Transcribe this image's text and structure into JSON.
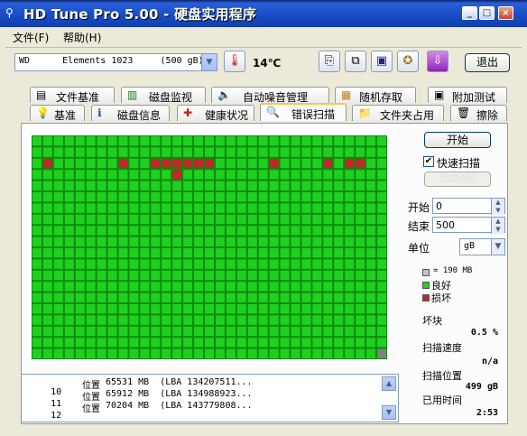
{
  "window": {
    "title": "HD Tune Pro 5.00 - 硬盘实用程序",
    "minimize": "_",
    "maximize": "□",
    "close": "×"
  },
  "menu": {
    "file": "文件(F)",
    "help": "帮助(H)"
  },
  "toolbar": {
    "drive_text": "WD      Elements 1023     (500 gB)",
    "temperature": "14℃",
    "exit_label": "退出"
  },
  "tabs_row1": [
    {
      "label": "文件基准",
      "icon": "file-benchmark-icon"
    },
    {
      "label": "磁盘监视",
      "icon": "disk-monitor-icon"
    },
    {
      "label": "自动噪音管理",
      "icon": "speaker-icon"
    },
    {
      "label": "随机存取",
      "icon": "random-access-icon"
    },
    {
      "label": "附加测试",
      "icon": "extra-tests-icon"
    }
  ],
  "tabs_row2": [
    {
      "label": "基准",
      "icon": "bulb-icon"
    },
    {
      "label": "磁盘信息",
      "icon": "info-icon"
    },
    {
      "label": "健康状况",
      "icon": "health-cross-icon"
    },
    {
      "label": "错误扫描",
      "icon": "magnifier-icon"
    },
    {
      "label": "文件夹占用",
      "icon": "folder-icon"
    },
    {
      "label": "擦除",
      "icon": "trash-icon"
    }
  ],
  "active_tab": "错误扫描",
  "scan": {
    "grid_cols": 33,
    "grid_rows": 20,
    "damaged_blocks": [
      [
        2,
        1
      ],
      [
        2,
        8
      ],
      [
        2,
        11
      ],
      [
        2,
        12
      ],
      [
        2,
        13
      ],
      [
        2,
        14
      ],
      [
        3,
        13
      ],
      [
        2,
        15
      ],
      [
        2,
        16
      ],
      [
        2,
        22
      ],
      [
        2,
        27
      ],
      [
        2,
        29
      ],
      [
        2,
        30
      ]
    ],
    "colors": {
      "good": "#1fd11f",
      "damaged": "#c0282a",
      "grid_line": "#0f8a0f",
      "unscanned": "#808080"
    }
  },
  "log_rows": [
    {
      "index": "10",
      "label": "位置",
      "text": "65531 MB  (LBA 134207511..."
    },
    {
      "index": "11",
      "label": "位置",
      "text": "65912 MB  (LBA 134988923..."
    },
    {
      "index": "12",
      "label": "位置",
      "text": "70204 MB  (LBA 143779808..."
    }
  ],
  "controls": {
    "start_button": "开始",
    "quick_scan_label": "快速扫描",
    "quick_scan_checked": true,
    "disabled_button": "快速扫描",
    "start_label": "开始",
    "start_value": "0",
    "end_label": "结束",
    "end_value": "500",
    "unit_label": "单位",
    "unit_value": "gB"
  },
  "legend": {
    "block_size": "= 190 MB",
    "good": "良好",
    "bad": "损坏"
  },
  "stats": {
    "bad_blocks_label": "坏块",
    "bad_blocks_value": "0.5 %",
    "scan_speed_label": "扫描速度",
    "scan_speed_value": "n/a",
    "scan_position_label": "扫描位置",
    "scan_position_value": "499 gB",
    "elapsed_label": "已用时间",
    "elapsed_value": "2:53"
  }
}
